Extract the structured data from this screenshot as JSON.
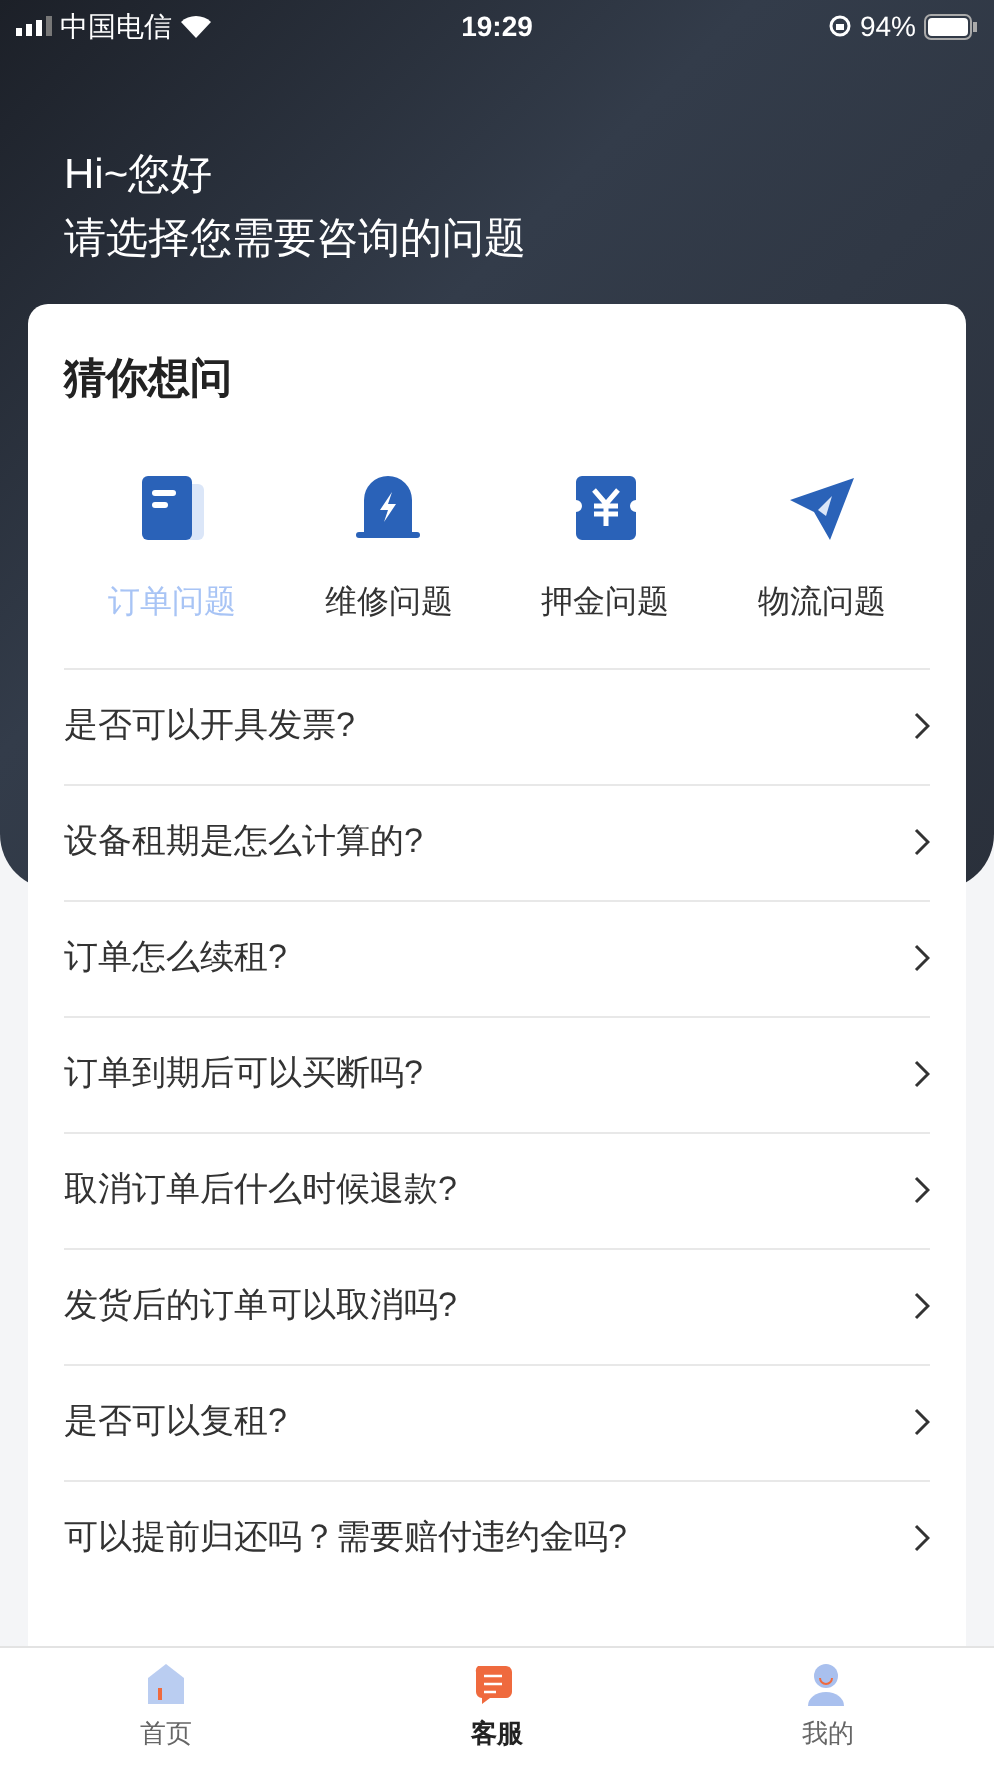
{
  "status_bar": {
    "carrier": "中国电信",
    "time": "19:29",
    "battery": "94%"
  },
  "header": {
    "greeting": "Hi~您好",
    "subtitle": "请选择您需要咨询的问题"
  },
  "card": {
    "title": "猜你想问",
    "categories": [
      {
        "label": "订单问题",
        "kind": "order",
        "selected": true
      },
      {
        "label": "维修问题",
        "kind": "repair",
        "selected": false
      },
      {
        "label": "押金问题",
        "kind": "deposit",
        "selected": false
      },
      {
        "label": "物流问题",
        "kind": "logistics",
        "selected": false
      }
    ],
    "questions": [
      "是否可以开具发票?",
      "设备租期是怎么计算的?",
      "订单怎么续租?",
      "订单到期后可以买断吗?",
      "取消订单后什么时候退款?",
      "发货后的订单可以取消吗?",
      "是否可以复租?",
      "可以提前归还吗？需要赔付违约金吗?"
    ]
  },
  "tab_bar": [
    {
      "label": "首页",
      "kind": "home",
      "selected": false
    },
    {
      "label": "客服",
      "kind": "service",
      "selected": true
    },
    {
      "label": "我的",
      "kind": "profile",
      "selected": false
    }
  ]
}
